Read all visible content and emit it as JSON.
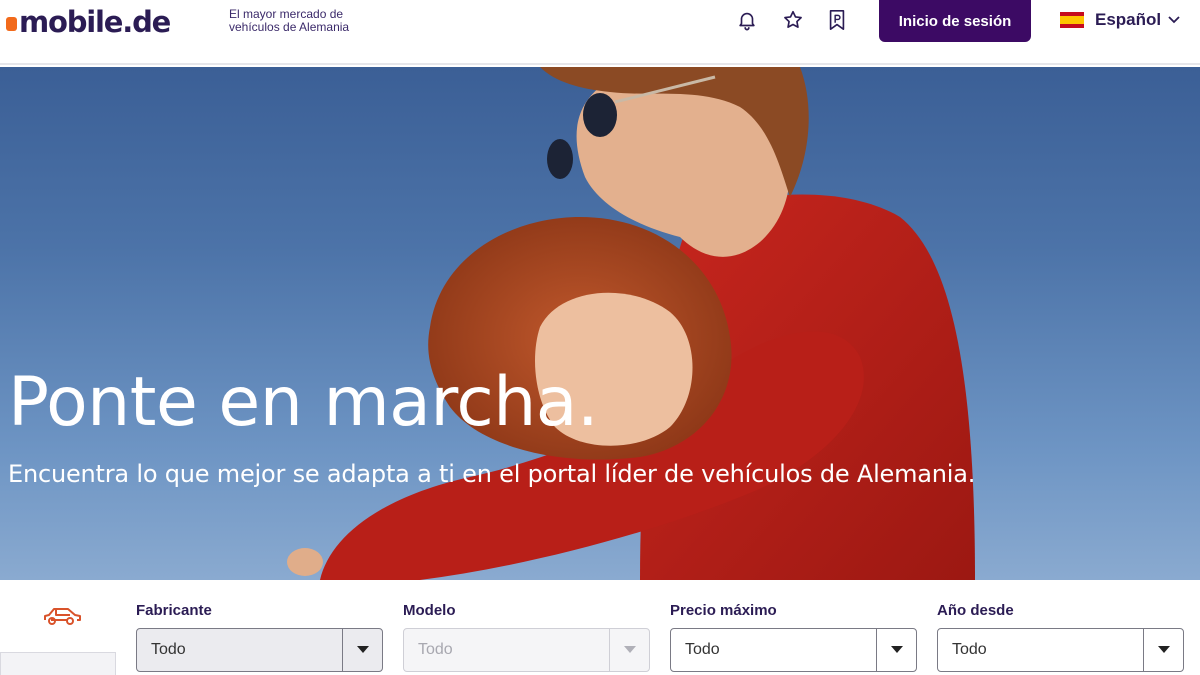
{
  "header": {
    "logo_text": "mobile.de",
    "tagline": "El mayor mercado de vehículos de Alemania",
    "icons": [
      "bell-icon",
      "star-icon",
      "parking-icon"
    ],
    "login_label": "Inicio de sesión",
    "language_label": "Español",
    "brand_color": "#3c0a64",
    "logo_accent": "#f26a1b"
  },
  "hero": {
    "title": "Ponte en marcha.",
    "subtitle": "Encuentra lo que mejor se adapta a ti en el portal líder de vehículos de Alemania."
  },
  "search": {
    "vehicle_icon": "car-icon",
    "fields": [
      {
        "label": "Fabricante",
        "value": "Todo"
      },
      {
        "label": "Modelo",
        "value": "Todo"
      },
      {
        "label": "Precio máximo",
        "value": "Todo"
      },
      {
        "label": "Año desde",
        "value": "Todo"
      }
    ]
  }
}
